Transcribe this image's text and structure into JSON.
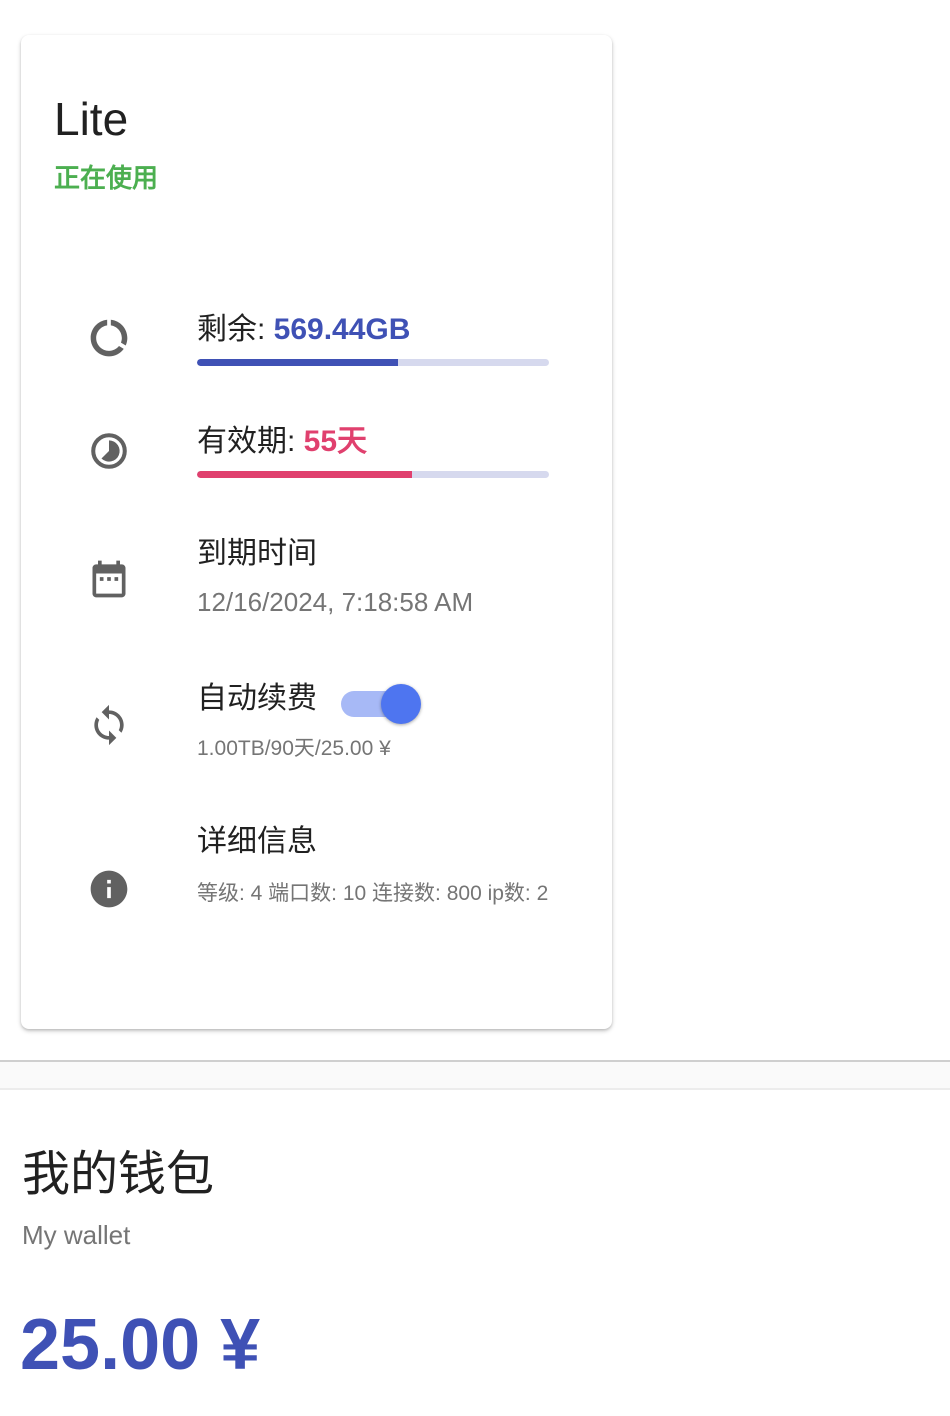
{
  "plan": {
    "name": "Lite",
    "status": "正在使用"
  },
  "remaining": {
    "label": "剩余: ",
    "value": "569.44GB",
    "progress_fraction": 0.57,
    "color": "#3f51b5",
    "icon": "donut-progress-icon"
  },
  "validity": {
    "label": "有效期: ",
    "value": "55天",
    "progress_fraction": 0.61,
    "color": "#e0406e",
    "icon": "timelapse-icon"
  },
  "expiry": {
    "label": "到期时间",
    "value": "12/16/2024, 7:18:58 AM",
    "icon": "calendar-icon"
  },
  "auto_renew": {
    "label": "自动续费",
    "enabled": true,
    "detail": "1.00TB/90天/25.00 ¥",
    "icon": "refresh-icon"
  },
  "details": {
    "label": "详细信息",
    "text": "等级: 4 端口数: 10 连接数: 800 ip数: 2",
    "icon": "info-icon"
  },
  "wallet": {
    "title": "我的钱包",
    "subtitle": "My wallet",
    "amount": "25.00 ¥",
    "amount_color": "#3f51b5"
  },
  "colors": {
    "status_green": "#4caf50",
    "toggle_on": "#4e75f0"
  }
}
